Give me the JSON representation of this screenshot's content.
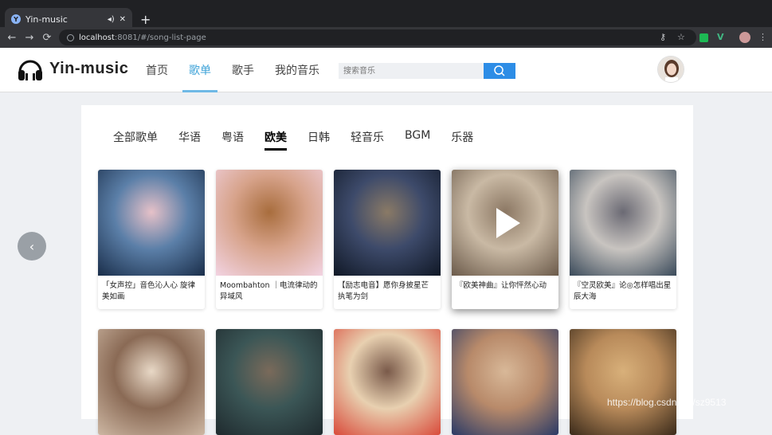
{
  "browser": {
    "tab_title": "Yin-music",
    "tab_favicon": "Y",
    "url_host": "localhost",
    "url_rest": ":8081/#/song-list-page"
  },
  "header": {
    "brand": "Yin-music",
    "nav": [
      {
        "label": "首页",
        "active": false
      },
      {
        "label": "歌单",
        "active": true
      },
      {
        "label": "歌手",
        "active": false
      },
      {
        "label": "我的音乐",
        "active": false
      }
    ],
    "search_placeholder": "搜索音乐",
    "accent": "#2d8de6"
  },
  "categories": [
    {
      "label": "全部歌单",
      "active": false
    },
    {
      "label": "华语",
      "active": false
    },
    {
      "label": "粤语",
      "active": false
    },
    {
      "label": "欧美",
      "active": true
    },
    {
      "label": "日韩",
      "active": false
    },
    {
      "label": "轻音乐",
      "active": false
    },
    {
      "label": "BGM",
      "active": false
    },
    {
      "label": "乐器",
      "active": false
    }
  ],
  "playlists_row1": [
    {
      "caption": "「女声控」音色沁人心 旋律美如画",
      "colors": [
        "#1a2e4a",
        "#5b7fa8",
        "#e6c1c8"
      ]
    },
    {
      "caption": "Moombahton ｜电流律动的异域风",
      "colors": [
        "#f2d3e2",
        "#d7a38b",
        "#a86d3d"
      ]
    },
    {
      "caption": "【励志电音】愿你身披星芒 执笔为剑",
      "colors": [
        "#101826",
        "#3d4a6a",
        "#8a7a66"
      ]
    },
    {
      "caption": "『欧美神曲』让你怦然心动",
      "colors": [
        "#6b5a4a",
        "#c9b9a4",
        "#8b7763"
      ]
    },
    {
      "caption": "『空灵欧美』论◎怎样唱出星辰大海",
      "colors": [
        "#3a4a5a",
        "#c8c4c0",
        "#6b6a74"
      ]
    }
  ],
  "playlists_row2": [
    {
      "caption": "",
      "colors": [
        "#cdb7a3",
        "#8a6a55",
        "#e8d8c6"
      ]
    },
    {
      "caption": "",
      "colors": [
        "#1f2a2e",
        "#3b5656",
        "#7a6a5a"
      ]
    },
    {
      "caption": "",
      "colors": [
        "#d94a3a",
        "#e8d0b0",
        "#7a5a4a"
      ]
    },
    {
      "caption": "",
      "colors": [
        "#2a3a66",
        "#b88a6a",
        "#d8b898"
      ]
    },
    {
      "caption": "",
      "colors": [
        "#3a2a1a",
        "#b88a5a",
        "#d8b07a"
      ]
    }
  ],
  "watermark": "https://blog.csdn.net/sz9513"
}
